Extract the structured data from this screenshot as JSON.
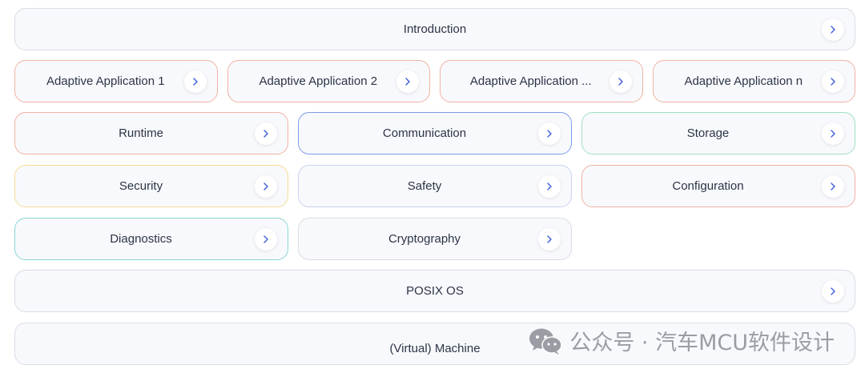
{
  "rows": [
    {
      "cards": [
        {
          "label": "Introduction",
          "border": "#d9dde6"
        }
      ]
    },
    {
      "cards": [
        {
          "label": "Adaptive Application 1",
          "border": "#f2b2a3"
        },
        {
          "label": "Adaptive Application 2",
          "border": "#f2b2a3"
        },
        {
          "label": "Adaptive Application ...",
          "border": "#f2b2a3"
        },
        {
          "label": "Adaptive Application n",
          "border": "#f2b2a3"
        }
      ]
    },
    {
      "cards": [
        {
          "label": "Runtime",
          "border": "#f2b2a3"
        },
        {
          "label": "Communication",
          "border": "#7b9de8"
        },
        {
          "label": "Storage",
          "border": "#9fe0c3"
        }
      ]
    },
    {
      "cards": [
        {
          "label": "Security",
          "border": "#f5de94"
        },
        {
          "label": "Safety",
          "border": "#c9d3ee"
        },
        {
          "label": "Configuration",
          "border": "#f2b2a3"
        }
      ]
    },
    {
      "cards": [
        {
          "label": "Diagnostics",
          "border": "#8bd6d6"
        },
        {
          "label": "Cryptography",
          "border": "#dadde4"
        }
      ]
    },
    {
      "cards": [
        {
          "label": "POSIX OS",
          "border": "#d9dde6"
        }
      ]
    },
    {
      "cards": [
        {
          "label": "(Virtual) Machine",
          "border": "#d9dde6"
        }
      ]
    }
  ],
  "watermark": {
    "text": "公众号 · 汽车MCU软件设计",
    "icon": "wechat-icon"
  }
}
